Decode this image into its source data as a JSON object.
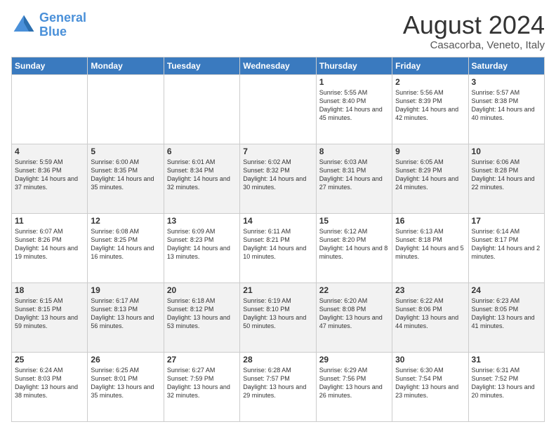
{
  "logo": {
    "text1": "General",
    "text2": "Blue"
  },
  "title": "August 2024",
  "subtitle": "Casacorba, Veneto, Italy",
  "headers": [
    "Sunday",
    "Monday",
    "Tuesday",
    "Wednesday",
    "Thursday",
    "Friday",
    "Saturday"
  ],
  "weeks": [
    [
      {
        "day": "",
        "info": ""
      },
      {
        "day": "",
        "info": ""
      },
      {
        "day": "",
        "info": ""
      },
      {
        "day": "",
        "info": ""
      },
      {
        "day": "1",
        "info": "Sunrise: 5:55 AM\nSunset: 8:40 PM\nDaylight: 14 hours and 45 minutes."
      },
      {
        "day": "2",
        "info": "Sunrise: 5:56 AM\nSunset: 8:39 PM\nDaylight: 14 hours and 42 minutes."
      },
      {
        "day": "3",
        "info": "Sunrise: 5:57 AM\nSunset: 8:38 PM\nDaylight: 14 hours and 40 minutes."
      }
    ],
    [
      {
        "day": "4",
        "info": "Sunrise: 5:59 AM\nSunset: 8:36 PM\nDaylight: 14 hours and 37 minutes."
      },
      {
        "day": "5",
        "info": "Sunrise: 6:00 AM\nSunset: 8:35 PM\nDaylight: 14 hours and 35 minutes."
      },
      {
        "day": "6",
        "info": "Sunrise: 6:01 AM\nSunset: 8:34 PM\nDaylight: 14 hours and 32 minutes."
      },
      {
        "day": "7",
        "info": "Sunrise: 6:02 AM\nSunset: 8:32 PM\nDaylight: 14 hours and 30 minutes."
      },
      {
        "day": "8",
        "info": "Sunrise: 6:03 AM\nSunset: 8:31 PM\nDaylight: 14 hours and 27 minutes."
      },
      {
        "day": "9",
        "info": "Sunrise: 6:05 AM\nSunset: 8:29 PM\nDaylight: 14 hours and 24 minutes."
      },
      {
        "day": "10",
        "info": "Sunrise: 6:06 AM\nSunset: 8:28 PM\nDaylight: 14 hours and 22 minutes."
      }
    ],
    [
      {
        "day": "11",
        "info": "Sunrise: 6:07 AM\nSunset: 8:26 PM\nDaylight: 14 hours and 19 minutes."
      },
      {
        "day": "12",
        "info": "Sunrise: 6:08 AM\nSunset: 8:25 PM\nDaylight: 14 hours and 16 minutes."
      },
      {
        "day": "13",
        "info": "Sunrise: 6:09 AM\nSunset: 8:23 PM\nDaylight: 14 hours and 13 minutes."
      },
      {
        "day": "14",
        "info": "Sunrise: 6:11 AM\nSunset: 8:21 PM\nDaylight: 14 hours and 10 minutes."
      },
      {
        "day": "15",
        "info": "Sunrise: 6:12 AM\nSunset: 8:20 PM\nDaylight: 14 hours and 8 minutes."
      },
      {
        "day": "16",
        "info": "Sunrise: 6:13 AM\nSunset: 8:18 PM\nDaylight: 14 hours and 5 minutes."
      },
      {
        "day": "17",
        "info": "Sunrise: 6:14 AM\nSunset: 8:17 PM\nDaylight: 14 hours and 2 minutes."
      }
    ],
    [
      {
        "day": "18",
        "info": "Sunrise: 6:15 AM\nSunset: 8:15 PM\nDaylight: 13 hours and 59 minutes."
      },
      {
        "day": "19",
        "info": "Sunrise: 6:17 AM\nSunset: 8:13 PM\nDaylight: 13 hours and 56 minutes."
      },
      {
        "day": "20",
        "info": "Sunrise: 6:18 AM\nSunset: 8:12 PM\nDaylight: 13 hours and 53 minutes."
      },
      {
        "day": "21",
        "info": "Sunrise: 6:19 AM\nSunset: 8:10 PM\nDaylight: 13 hours and 50 minutes."
      },
      {
        "day": "22",
        "info": "Sunrise: 6:20 AM\nSunset: 8:08 PM\nDaylight: 13 hours and 47 minutes."
      },
      {
        "day": "23",
        "info": "Sunrise: 6:22 AM\nSunset: 8:06 PM\nDaylight: 13 hours and 44 minutes."
      },
      {
        "day": "24",
        "info": "Sunrise: 6:23 AM\nSunset: 8:05 PM\nDaylight: 13 hours and 41 minutes."
      }
    ],
    [
      {
        "day": "25",
        "info": "Sunrise: 6:24 AM\nSunset: 8:03 PM\nDaylight: 13 hours and 38 minutes."
      },
      {
        "day": "26",
        "info": "Sunrise: 6:25 AM\nSunset: 8:01 PM\nDaylight: 13 hours and 35 minutes."
      },
      {
        "day": "27",
        "info": "Sunrise: 6:27 AM\nSunset: 7:59 PM\nDaylight: 13 hours and 32 minutes."
      },
      {
        "day": "28",
        "info": "Sunrise: 6:28 AM\nSunset: 7:57 PM\nDaylight: 13 hours and 29 minutes."
      },
      {
        "day": "29",
        "info": "Sunrise: 6:29 AM\nSunset: 7:56 PM\nDaylight: 13 hours and 26 minutes."
      },
      {
        "day": "30",
        "info": "Sunrise: 6:30 AM\nSunset: 7:54 PM\nDaylight: 13 hours and 23 minutes."
      },
      {
        "day": "31",
        "info": "Sunrise: 6:31 AM\nSunset: 7:52 PM\nDaylight: 13 hours and 20 minutes."
      }
    ]
  ]
}
